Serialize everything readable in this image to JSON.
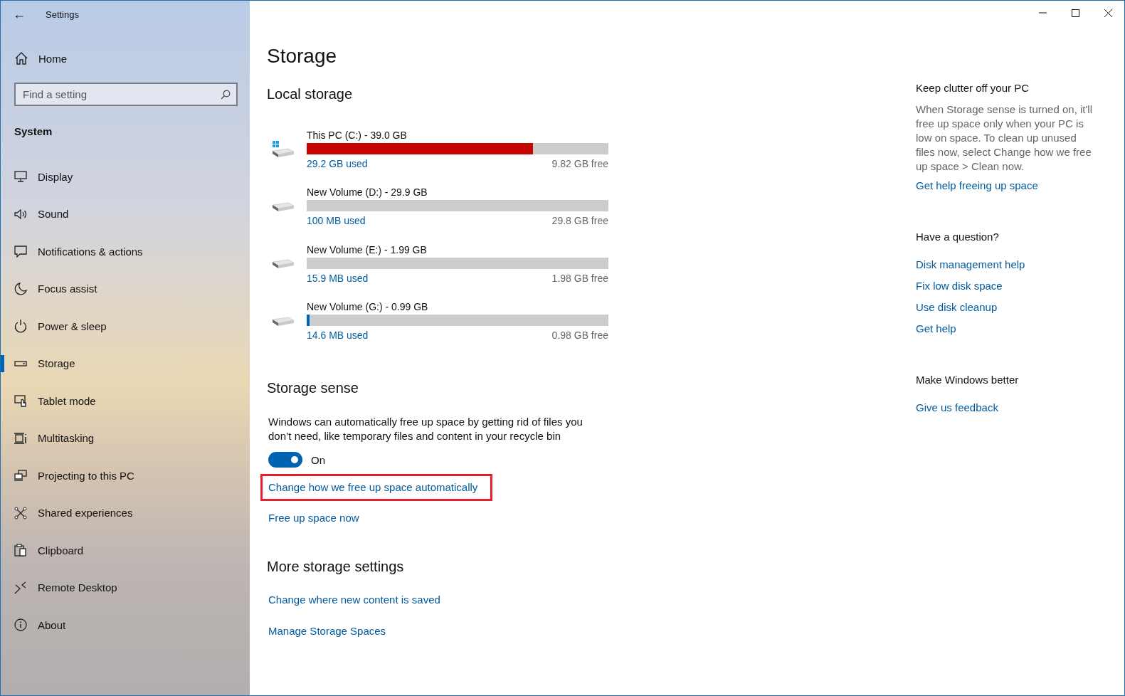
{
  "window": {
    "title": "Settings",
    "back": "←"
  },
  "sidebar": {
    "home": "Home",
    "search": {
      "placeholder": "Find a setting"
    },
    "section": "System",
    "items": [
      {
        "label": "Display",
        "selected": false
      },
      {
        "label": "Sound",
        "selected": false
      },
      {
        "label": "Notifications & actions",
        "selected": false
      },
      {
        "label": "Focus assist",
        "selected": false
      },
      {
        "label": "Power & sleep",
        "selected": false
      },
      {
        "label": "Storage",
        "selected": true
      },
      {
        "label": "Tablet mode",
        "selected": false
      },
      {
        "label": "Multitasking",
        "selected": false
      },
      {
        "label": "Projecting to this PC",
        "selected": false
      },
      {
        "label": "Shared experiences",
        "selected": false
      },
      {
        "label": "Clipboard",
        "selected": false
      },
      {
        "label": "Remote Desktop",
        "selected": false
      },
      {
        "label": "About",
        "selected": false
      }
    ]
  },
  "page": {
    "title": "Storage",
    "local_storage": {
      "heading": "Local storage",
      "drives": [
        {
          "kind": "system",
          "name": "This PC (C:) - 39.0 GB",
          "level": 0.749,
          "color": "#c50500",
          "used": "29.2 GB used",
          "free": "9.82 GB free"
        },
        {
          "kind": "volume",
          "name": "New Volume (D:) - 29.9 GB",
          "level": 0,
          "used": "100 MB used",
          "free": "29.8 GB free"
        },
        {
          "kind": "volume",
          "name": "New Volume (E:) - 1.99 GB",
          "level": 0,
          "used": "15.9 MB used",
          "free": "1.98 GB free"
        },
        {
          "kind": "volume",
          "name": "New Volume (G:) - 0.99 GB",
          "level": 0.01,
          "color": "#0063b1",
          "used": "14.6 MB used",
          "free": "0.98 GB free"
        }
      ]
    },
    "storage_sense": {
      "heading": "Storage sense",
      "description": "Windows can automatically free up space by getting rid of files you don’t need, like temporary files and content in your recycle bin",
      "toggle": {
        "on": true,
        "label": "On"
      },
      "links": [
        {
          "label": "Change how we free up space automatically",
          "highlighted": true
        },
        {
          "label": "Free up space now",
          "highlighted": false
        }
      ]
    },
    "more": {
      "heading": "More storage settings",
      "links": [
        "Change where new content is saved",
        "Manage Storage Spaces"
      ]
    }
  },
  "aside": [
    {
      "heading": "Keep clutter off your PC",
      "text": "When Storage sense is turned on, it'll free up space only when your PC is low on space. To clean up unused files now, select Change how we free up space > Clean now.",
      "links": [
        "Get help freeing up space"
      ]
    },
    {
      "heading": "Have a question?",
      "links": [
        "Disk management help",
        "Fix low disk space",
        "Use disk cleanup",
        "Get help"
      ]
    },
    {
      "heading": "Make Windows better",
      "links": [
        "Give us feedback"
      ]
    }
  ]
}
